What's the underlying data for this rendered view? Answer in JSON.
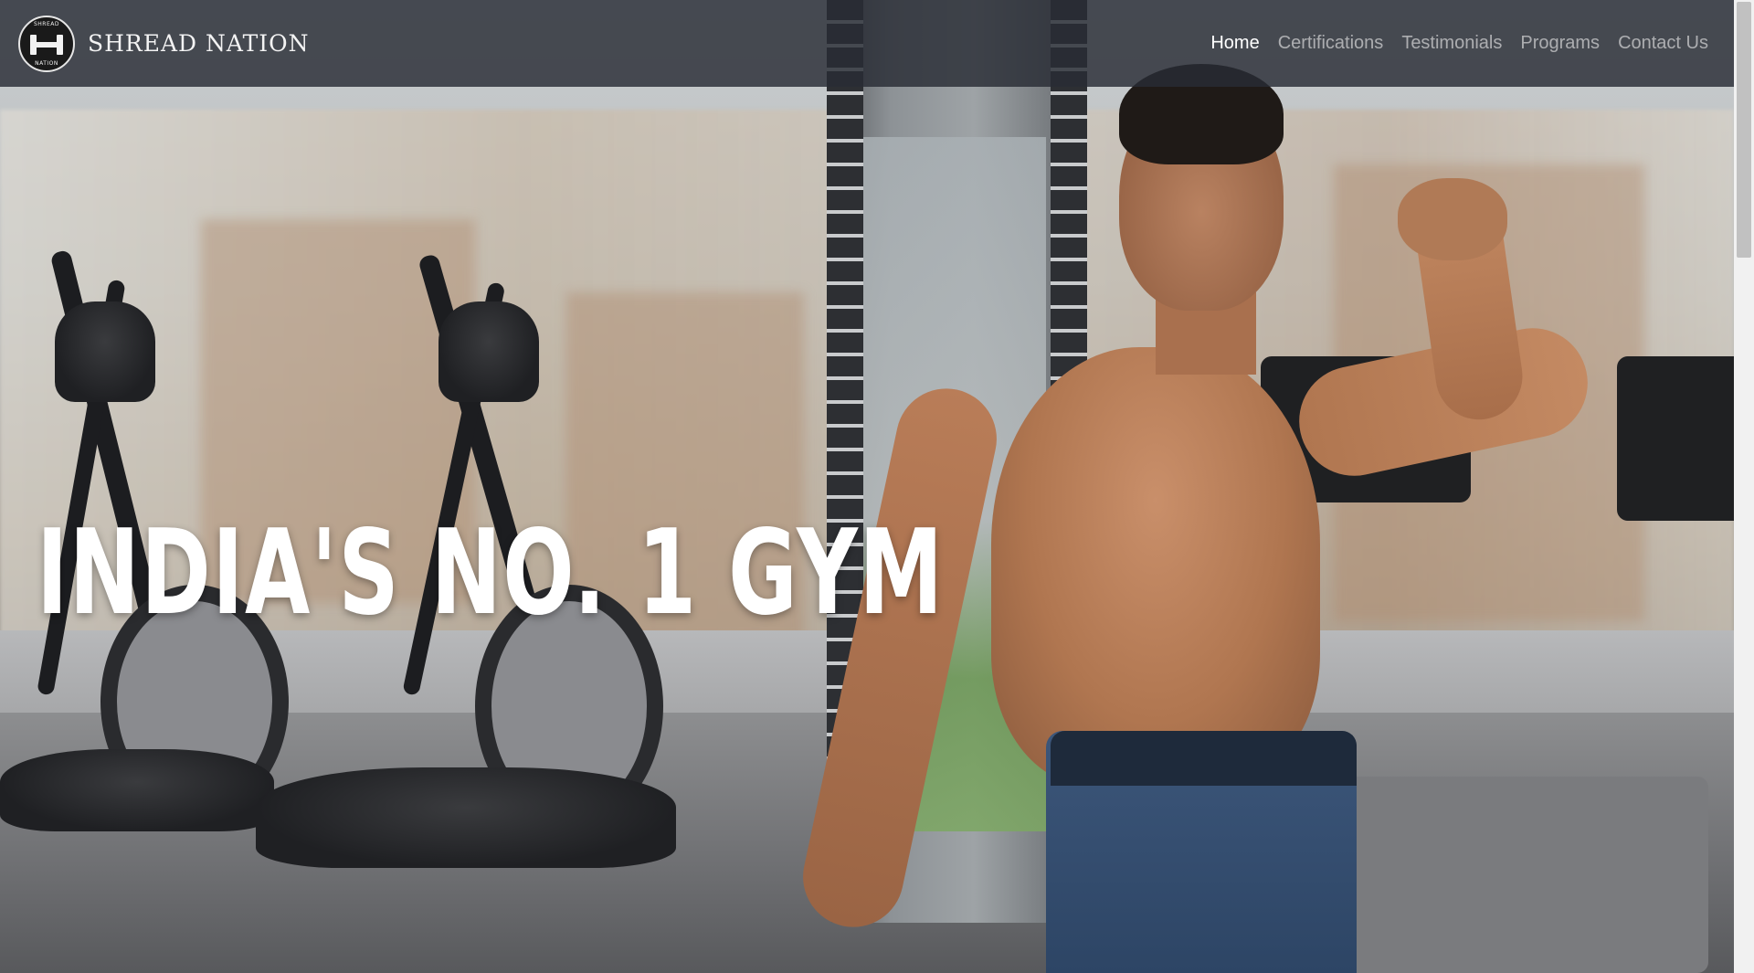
{
  "brand": {
    "logo_top_text": "SHREAD",
    "logo_bottom_text": "NATION",
    "name": "SHREAD NATION"
  },
  "nav": {
    "items": [
      {
        "label": "Home",
        "active": true
      },
      {
        "label": "Certifications",
        "active": false
      },
      {
        "label": "Testimonials",
        "active": false
      },
      {
        "label": "Programs",
        "active": false
      },
      {
        "label": "Contact Us",
        "active": false
      }
    ]
  },
  "hero": {
    "headline": "INDIA'S NO. 1 GYM",
    "image_icon": "hero-photo"
  },
  "colors": {
    "navbar_bg": "#282c34",
    "nav_active": "#ffffff",
    "nav_inactive": "#b5b7ba",
    "headline": "#ffffff"
  }
}
